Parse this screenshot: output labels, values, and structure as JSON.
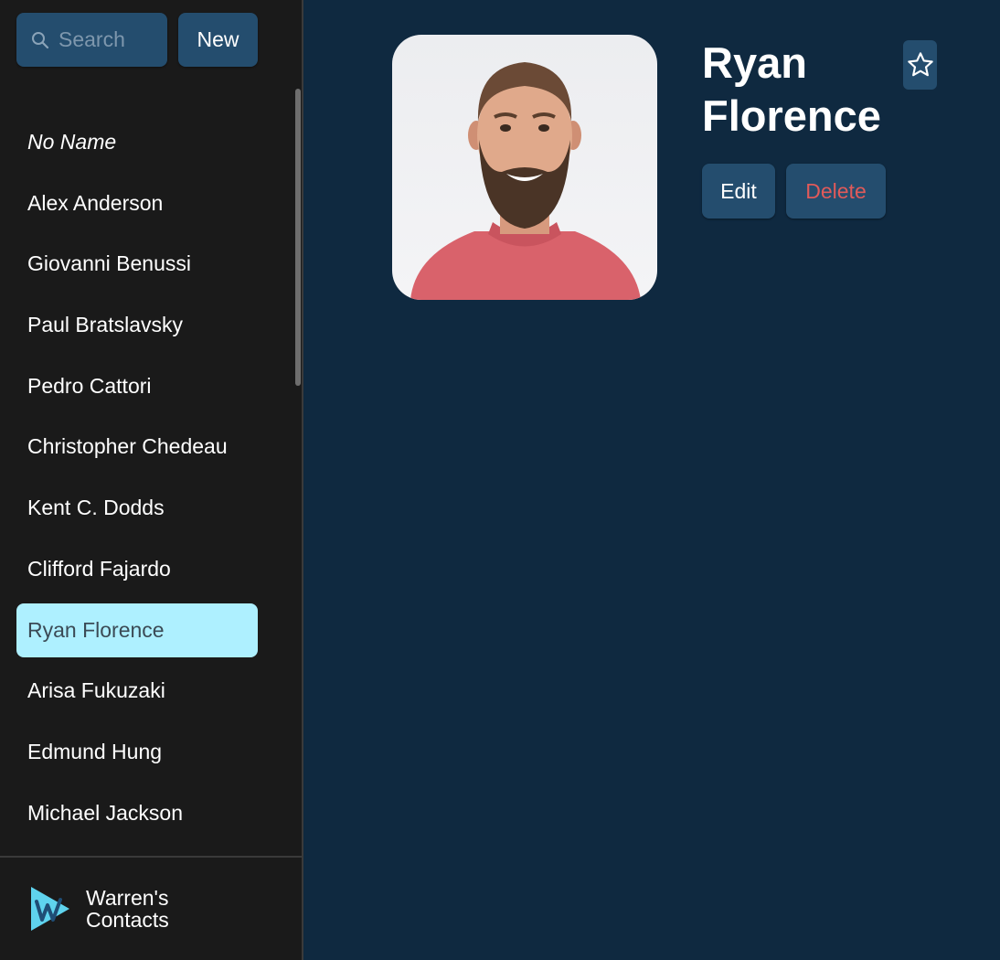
{
  "colors": {
    "main_bg": "#0f2940",
    "sidebar_bg": "#1a1a1a",
    "button_bg": "#244d6e",
    "active_item_bg": "#aef0ff",
    "delete_text": "#e05a5a"
  },
  "sidebar": {
    "search": {
      "placeholder": "Search",
      "value": "",
      "icon": "search-icon"
    },
    "new_label": "New",
    "contacts": [
      {
        "label": "No Name"
      },
      {
        "label": "Alex Anderson"
      },
      {
        "label": "Giovanni Benussi"
      },
      {
        "label": "Paul Bratslavsky"
      },
      {
        "label": "Pedro Cattori"
      },
      {
        "label": "Christopher Chedeau"
      },
      {
        "label": "Kent C. Dodds"
      },
      {
        "label": "Clifford Fajardo"
      },
      {
        "label": "Ryan Florence"
      },
      {
        "label": "Arisa Fukuzaki"
      },
      {
        "label": "Edmund Hung"
      },
      {
        "label": "Michael Jackson"
      }
    ],
    "active_contact": "Ryan Florence",
    "footer": {
      "title_line1": "Warren's",
      "title_line2": "Contacts",
      "logo_icon": "warren-logo-icon"
    }
  },
  "contact": {
    "name": "Ryan Florence",
    "favorite": false,
    "star_icon": "star-outline-icon",
    "edit_label": "Edit",
    "delete_label": "Delete"
  }
}
